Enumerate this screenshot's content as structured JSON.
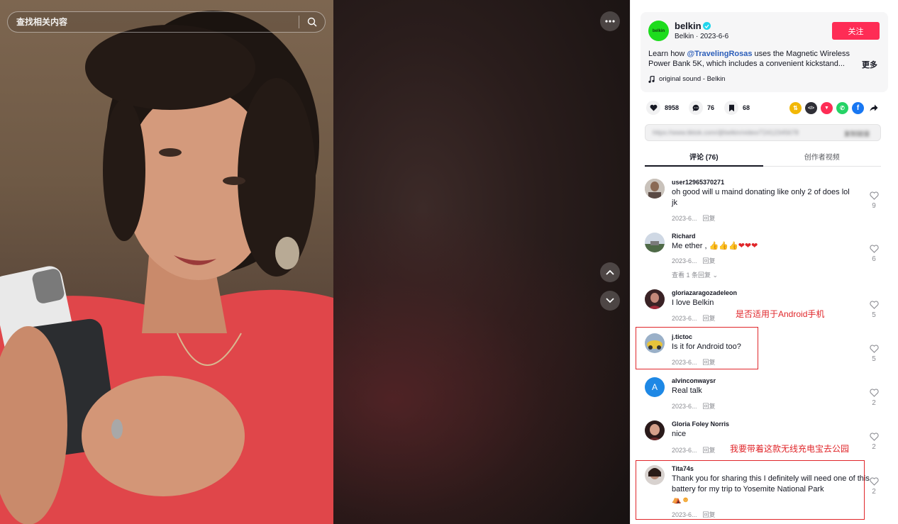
{
  "search": {
    "placeholder": "查找相关内容"
  },
  "author": {
    "avatar_text": "belkin",
    "name": "belkin",
    "subline": "Belkin · 2023-6-6",
    "follow_label": "关注"
  },
  "description": {
    "prefix": "Learn how ",
    "mention": "@TravelingRosas",
    "suffix": " uses the Magnetic Wireless Power Bank 5K, which includes a convenient kickstand...",
    "more_label": "更多"
  },
  "sound": {
    "icon": "music-note-icon",
    "label": "original sound - Belkin"
  },
  "stats": {
    "likes": "8958",
    "comments": "76",
    "saves": "68"
  },
  "share_icons": [
    {
      "name": "friends-share-icon",
      "color": "#f2b705",
      "glyph": "⇅"
    },
    {
      "name": "embed-icon",
      "color": "#2f2f36",
      "glyph": "</>"
    },
    {
      "name": "send-icon",
      "color": "#fe2c55",
      "glyph": "▼"
    },
    {
      "name": "whatsapp-icon",
      "color": "#25d366",
      "glyph": "✆"
    },
    {
      "name": "facebook-icon",
      "color": "#1877f2",
      "glyph": "f"
    }
  ],
  "link": {
    "blurred_url": "https://www.tiktok.com/@belkin/video/72412345678",
    "copy_label": "复制链接"
  },
  "tabs": [
    {
      "label": "评论 (76)",
      "active": true
    },
    {
      "label": "创作者视频",
      "active": false
    }
  ],
  "comments": [
    {
      "user": "user12965370271",
      "text": "oh good will u maind donating like only 2 of does lol jk",
      "date": "2023-6...",
      "reply": "回复",
      "likes": "9"
    },
    {
      "user": "Richard",
      "text": "Me ether ,",
      "date": "2023-6...",
      "reply": "回复",
      "likes": "6",
      "view_replies": "查看 1 条回复"
    },
    {
      "user": "gloriazaragozadeleon",
      "text": "I love Belkin",
      "date": "2023-6...",
      "reply": "回复",
      "likes": "5"
    },
    {
      "user": "j.tictoc",
      "text": "Is it for Android too?",
      "date": "2023-6...",
      "reply": "回复",
      "likes": "5"
    },
    {
      "user": "alvinconwaysr",
      "avatar_letter": "A",
      "text": "Real talk",
      "date": "2023-6...",
      "reply": "回复",
      "likes": "2"
    },
    {
      "user": "Gloria Foley Norris",
      "text": "nice",
      "date": "2023-6...",
      "reply": "回复",
      "likes": "2"
    },
    {
      "user": "Tita74s",
      "text": "Thank you for sharing this I definitely will need one of this battery for my trip to Yosemite National Park",
      "date": "2023-6...",
      "reply": "回复",
      "likes": "2"
    }
  ],
  "annotations": [
    {
      "text": "是否适用于Android手机"
    },
    {
      "text": "我要带着这款无线充电宝去公园"
    }
  ],
  "colors": {
    "accent": "#fe2c55",
    "annotation": "#e0262a",
    "link": "#2b5db9"
  }
}
